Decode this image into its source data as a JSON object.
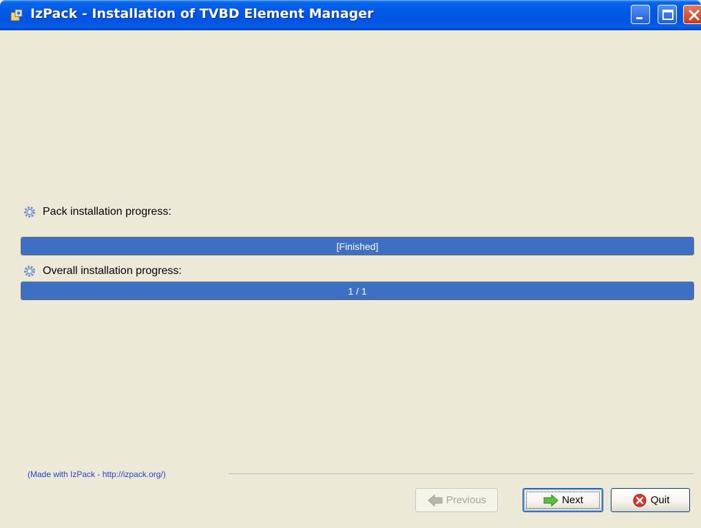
{
  "window": {
    "title": "IzPack - Installation of TVBD Element Manager",
    "icons": {
      "app": "app-installer-icon",
      "minimize": "minimize-icon",
      "maximize": "maximize-icon",
      "close": "close-icon"
    }
  },
  "progress": {
    "pack": {
      "label": "Pack installation progress:",
      "status_text": "[Finished]",
      "percent": 100,
      "icon": "gear-icon"
    },
    "overall": {
      "label": "Overall installation progress:",
      "status_text": "1 / 1",
      "percent": 100,
      "icon": "gear-icon"
    }
  },
  "footer": {
    "made_with": "(Made with IzPack - http://izpack.org/)"
  },
  "buttons": {
    "previous": {
      "label": "Previous",
      "enabled": false,
      "icon": "arrow-left-icon"
    },
    "next": {
      "label": "Next",
      "enabled": true,
      "icon": "arrow-right-icon"
    },
    "quit": {
      "label": "Quit",
      "enabled": true,
      "icon": "quit-x-icon"
    }
  },
  "colors": {
    "progress_fill": "#3d6fc4",
    "window_bg": "#ece9d8",
    "titlebar": "#0054e3",
    "link": "#2a3fc9"
  }
}
